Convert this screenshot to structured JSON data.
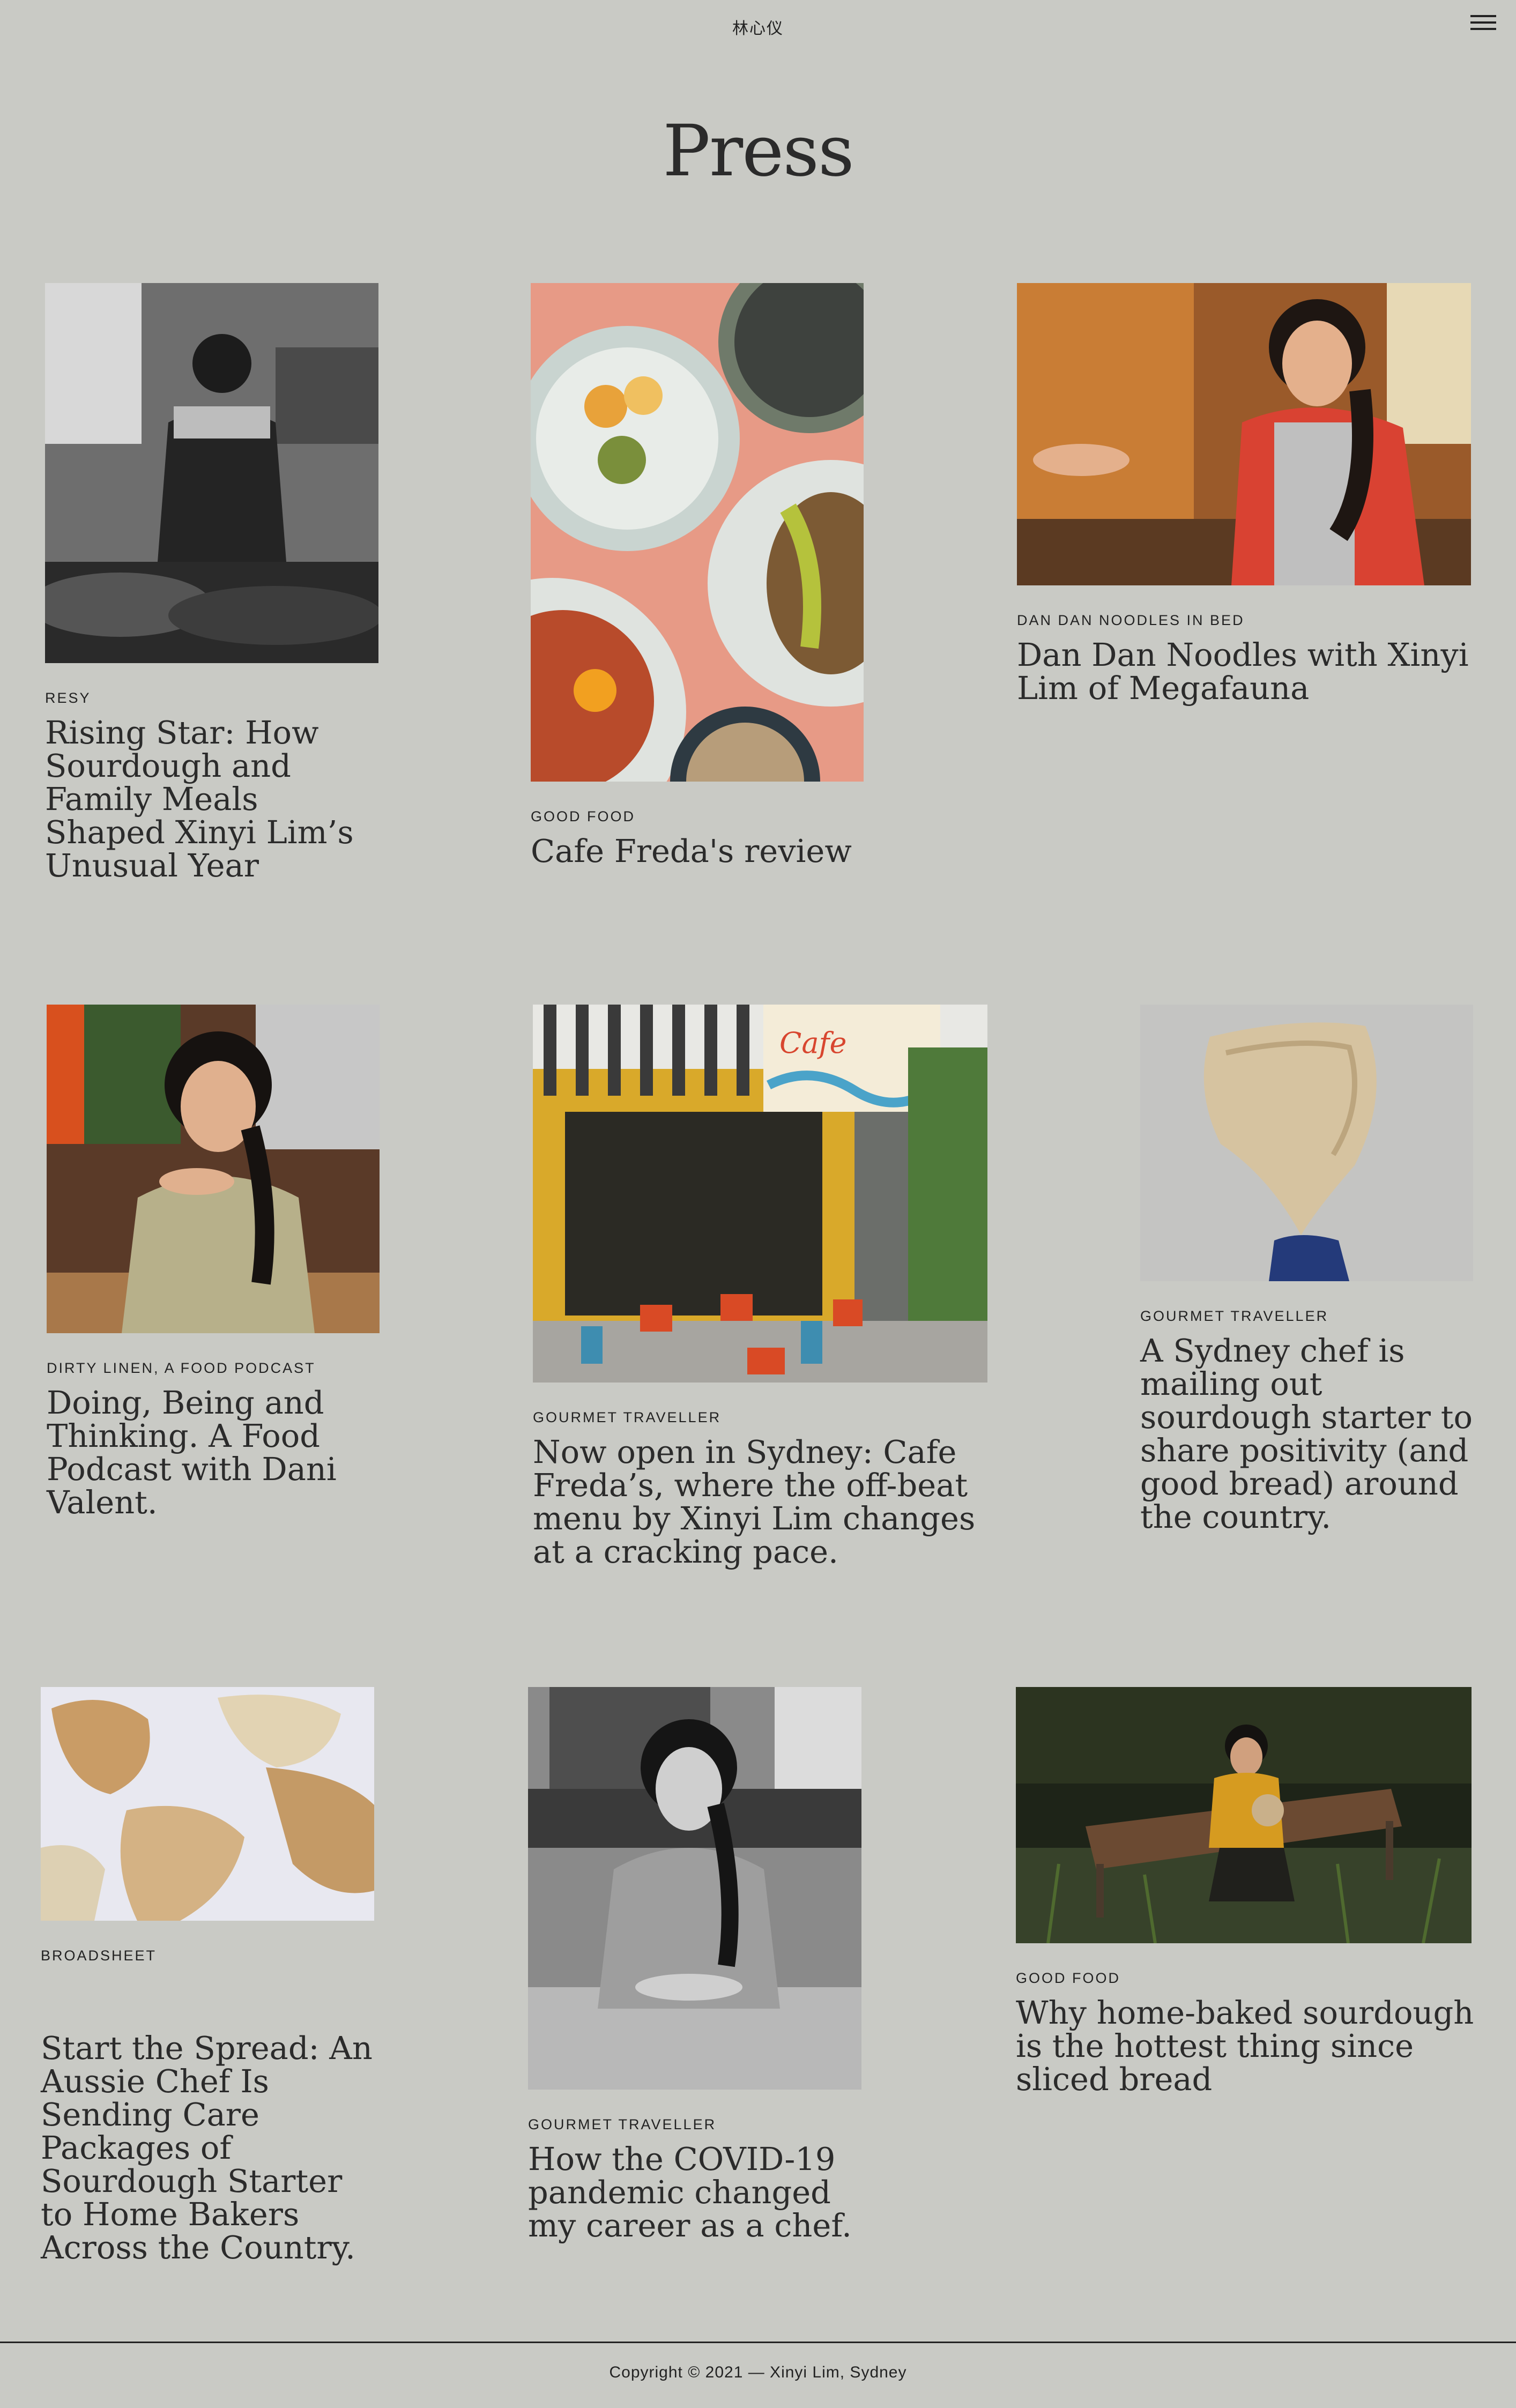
{
  "site": {
    "title": "林心仪",
    "menu_icon": "hamburger-menu-icon"
  },
  "page_title": "Press",
  "articles": [
    {
      "source": "Resy",
      "headline": "Rising Star: How Sourdough and Family Meals Shaped Xinyi Lim’s Unusual Year",
      "image": "chef-cooking-bw-photo"
    },
    {
      "source": "Good Food",
      "headline": "Cafe Freda's review",
      "image": "plated-dishes-overhead-photo"
    },
    {
      "source": "Dan Dan Noodles in Bed",
      "headline": "Dan Dan Noodles with Xinyi Lim of Megafauna",
      "image": "chef-laughing-kitchen-photo"
    },
    {
      "source": "Dirty Linen, A Food Podcast",
      "headline": "Doing, Being and Thinking. A Food Podcast with Dani Valent.",
      "image": "chef-portrait-kitchen-photo"
    },
    {
      "source": "Gourmet Traveller",
      "headline": "Now open in Sydney: Cafe Freda’s, where the off-beat menu by Xinyi Lim changes at a cracking pace.",
      "image": "cafe-freda-storefront-photo"
    },
    {
      "source": "Gourmet Traveller",
      "headline": "A Sydney chef is mailing out sourdough starter to share positivity (and good bread) around the country.",
      "image": "dried-sourdough-starter-photo"
    },
    {
      "source": "Broadsheet",
      "headline": "Start the Spread: An Aussie Chef Is Sending Care Packages of Sourdough Starter to Home Bakers Across the Country.",
      "image": "sourdough-flakes-photo"
    },
    {
      "source": "Gourmet Traveller",
      "headline": "How the COVID-19 pandemic changed my career as a chef.",
      "image": "chef-seated-bw-photo"
    },
    {
      "source": "Good Food",
      "headline": "Why home-baked sourdough is the hottest thing since sliced bread",
      "image": "chef-on-park-bench-photo"
    }
  ],
  "footer": {
    "copyright": "Copyright © 2021 — Xinyi Lim, Sydney"
  }
}
